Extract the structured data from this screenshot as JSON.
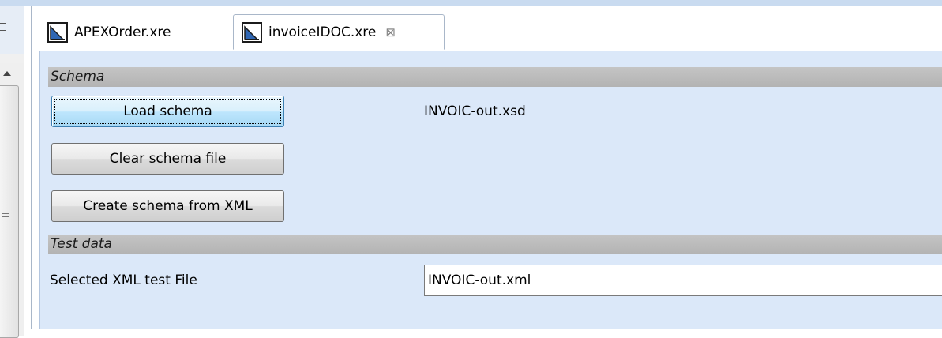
{
  "tabs": [
    {
      "label": "APEXOrder.xre",
      "active": false
    },
    {
      "label": "invoiceIDOC.xre",
      "active": true,
      "close_glyph": "⊠"
    }
  ],
  "schema_section": {
    "title": "Schema",
    "load_button": "Load schema",
    "clear_button": "Clear schema file",
    "create_button": "Create schema from XML",
    "schema_file": "INVOIC-out.xsd"
  },
  "test_section": {
    "title": "Test data",
    "selected_label": "Selected XML test File",
    "selected_value": "INVOIC-out.xml"
  },
  "colors": {
    "editor_background": "#dbe8f9",
    "section_header": "#bcbcbc",
    "focus_button": "#bee6fd"
  },
  "icons": [
    "restore-icon",
    "file-icon",
    "close-icon",
    "scroll-up-icon",
    "grip-icon"
  ]
}
